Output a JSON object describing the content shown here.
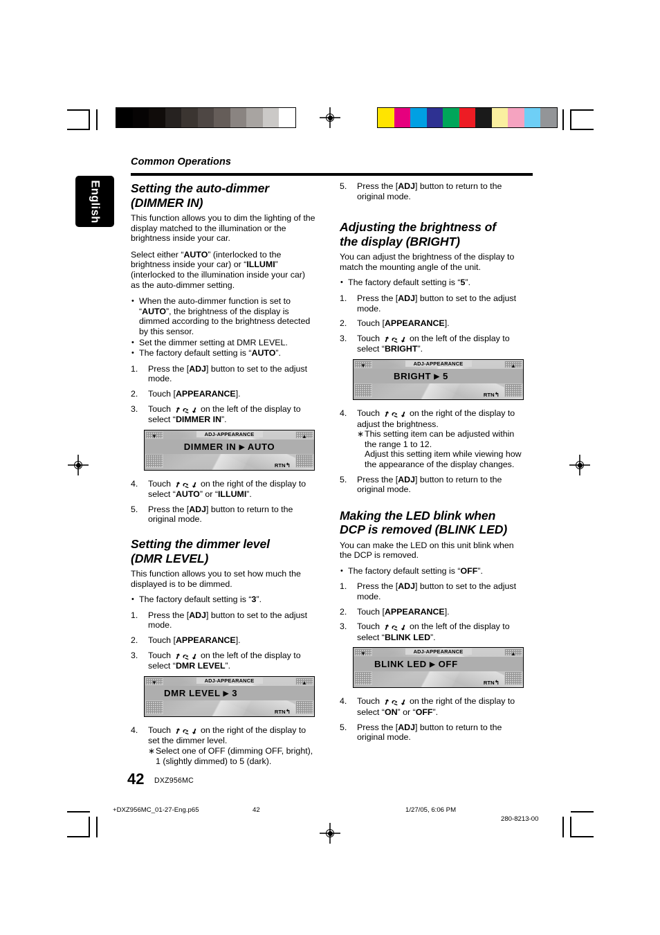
{
  "header": {
    "section_kicker": "Common Operations",
    "language_tab": "English"
  },
  "colors": {
    "gray_strip": [
      "#000000",
      "#060404",
      "#100c0a",
      "#262220",
      "#3b3531",
      "#4e4744",
      "#655d59",
      "#8a8481",
      "#a8a4a1",
      "#cbc9c7",
      "#ffffff"
    ],
    "color_strip": [
      "#ffe400",
      "#e6007e",
      "#00a0e3",
      "#2e3192",
      "#00a65a",
      "#ed1c24",
      "#1a1a1a",
      "#faefa0",
      "#f5a3c0",
      "#6ecff6",
      "#939598"
    ]
  },
  "left_column": {
    "section1": {
      "title_line1": "Setting the auto-dimmer",
      "title_line2": "(DIMMER IN)",
      "para1": "This function allows you to dim the lighting of the display matched to the illumination or the brightness inside your car.",
      "para2_parts": [
        "Select either “",
        "AUTO",
        "” (interlocked to the brightness inside your car) or “",
        "ILLUMI",
        "” (interlocked to the illumination inside your car) as the auto-dimmer setting."
      ],
      "bullets": [
        {
          "parts": [
            "When the auto-dimmer function is set to “",
            "AUTO",
            "”, the brightness of the display is dimmed according to the brightness detected by this sensor."
          ]
        },
        {
          "parts": [
            "Set the dimmer setting at DMR LEVEL.",
            "",
            ""
          ]
        },
        {
          "parts": [
            "The factory default setting is “",
            "AUTO",
            "”."
          ]
        }
      ],
      "steps": [
        {
          "num": "1.",
          "parts": [
            "Press the [",
            "ADJ",
            "] button to set to the adjust mode."
          ]
        },
        {
          "num": "2.",
          "parts": [
            "Touch [",
            "APPEARANCE",
            "]."
          ]
        },
        {
          "num": "3.",
          "parts": [
            "Touch ",
            "GLYPH",
            " on the left of the display to select “",
            "DIMMER IN",
            "”."
          ]
        },
        {
          "num": "4.",
          "parts": [
            "Touch ",
            "GLYPH",
            " on the right of the display to select “",
            "AUTO",
            "” or “",
            "ILLUMI",
            "”."
          ]
        },
        {
          "num": "5.",
          "parts": [
            "Press the [",
            "ADJ",
            "] button to return to the original mode."
          ]
        }
      ],
      "lcd": {
        "title": "ADJ-APPEARANCE",
        "item": "DIMMER IN",
        "arrow": "▶",
        "value": "AUTO",
        "rtn": "RTN"
      }
    },
    "section2": {
      "title_line1": "Setting the dimmer level",
      "title_line2": "(DMR LEVEL)",
      "para1": "This function allows you to set how much the displayed is to be dimmed.",
      "bullets": [
        {
          "parts": [
            "The factory default setting is “",
            "3",
            "”."
          ]
        }
      ],
      "steps": [
        {
          "num": "1.",
          "parts": [
            "Press the [",
            "ADJ",
            "] button to set to the adjust mode."
          ]
        },
        {
          "num": "2.",
          "parts": [
            "Touch [",
            "APPEARANCE",
            "]."
          ]
        },
        {
          "num": "3.",
          "parts": [
            "Touch ",
            "GLYPH",
            " on the left of the display to select “",
            "DMR LEVEL",
            "”."
          ]
        },
        {
          "num": "4.",
          "parts": [
            "Touch ",
            "GLYPH",
            " on the right of the display to set the dimmer level."
          ],
          "sub": "Select one of OFF (dimming OFF, bright), 1 (slightly dimmed) to 5 (dark)."
        }
      ],
      "lcd": {
        "title": "ADJ-APPEARANCE",
        "item": "DMR LEVEL",
        "arrow": "▶",
        "value": "3",
        "rtn": "RTN"
      }
    }
  },
  "right_column": {
    "lead_step": {
      "num": "5.",
      "parts": [
        "Press the [",
        "ADJ",
        "] button to return to the original mode."
      ]
    },
    "section3": {
      "title_line1": "Adjusting the brightness of",
      "title_line2": "the display (BRIGHT)",
      "para1": "You can adjust the brightness of the display to match the mounting angle of the unit.",
      "bullets": [
        {
          "parts": [
            "The factory default setting is “",
            "5",
            "”."
          ]
        }
      ],
      "steps": [
        {
          "num": "1.",
          "parts": [
            "Press the [",
            "ADJ",
            "] button to set to the adjust mode."
          ]
        },
        {
          "num": "2.",
          "parts": [
            "Touch [",
            "APPEARANCE",
            "]."
          ]
        },
        {
          "num": "3.",
          "parts": [
            "Touch ",
            "GLYPH",
            " on the left of the display to select “",
            "BRIGHT",
            "”."
          ]
        },
        {
          "num": "4.",
          "parts": [
            "Touch ",
            "GLYPH",
            " on the right of the display to adjust the brightness."
          ],
          "sub": "This setting item can be adjusted within the range 1 to 12.\nAdjust this setting item while viewing how the appearance of the display changes."
        },
        {
          "num": "5.",
          "parts": [
            "Press the [",
            "ADJ",
            "] button to return to the original mode."
          ]
        }
      ],
      "lcd": {
        "title": "ADJ-APPEARANCE",
        "item": "BRIGHT",
        "arrow": "▶",
        "value": "5",
        "rtn": "RTN"
      }
    },
    "section4": {
      "title_line1": "Making the LED blink when",
      "title_line2": "DCP is removed (BLINK LED)",
      "para1": "You can make the LED on this unit blink when the DCP is removed.",
      "bullets": [
        {
          "parts": [
            "The factory default setting is “",
            "OFF",
            "”."
          ]
        }
      ],
      "steps": [
        {
          "num": "1.",
          "parts": [
            "Press the [",
            "ADJ",
            "] button to set to the adjust mode."
          ]
        },
        {
          "num": "2.",
          "parts": [
            "Touch [",
            "APPEARANCE",
            "]."
          ]
        },
        {
          "num": "3.",
          "parts": [
            "Touch ",
            "GLYPH",
            " on the left of the display to select “",
            "BLINK LED",
            "”."
          ]
        },
        {
          "num": "4.",
          "parts": [
            "Touch ",
            "GLYPH",
            " on the right of the display to select “",
            "ON",
            "” or “",
            "OFF",
            "”."
          ]
        },
        {
          "num": "5.",
          "parts": [
            "Press the [",
            "ADJ",
            "] button to return to the original mode."
          ]
        }
      ],
      "lcd": {
        "title": "ADJ-APPEARANCE",
        "item": "BLINK LED",
        "arrow": "▶",
        "value": "OFF",
        "rtn": "RTN"
      }
    }
  },
  "footer": {
    "page_number": "42",
    "model": "DXZ956MC",
    "file_name": "+DXZ956MC_01-27-Eng.p65",
    "slug_page": "42",
    "timestamp": "1/27/05, 6:06 PM",
    "doc_code": "280-8213-00"
  }
}
